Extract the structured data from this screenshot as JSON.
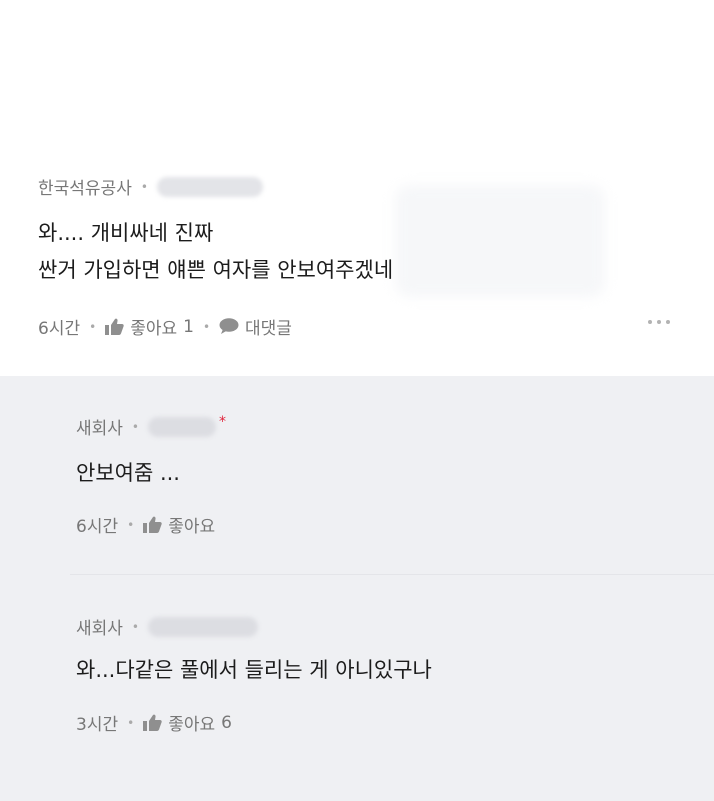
{
  "comment": {
    "author": "한국석유공사",
    "lines": [
      "와.... 개비싸네 진짜",
      "싼거 가입하면 얘쁜 여자를 안보여주겠네"
    ],
    "time": "6시간",
    "like_label": "좋아요",
    "like_count": "1",
    "reply_label": "대댓글",
    "more_icon": "more-dots-icon"
  },
  "replies": [
    {
      "author": "새회사",
      "author_suffix": "*",
      "text": "안보여줌 ...",
      "time": "6시간",
      "like_label": "좋아요",
      "like_count": ""
    },
    {
      "author": "새회사",
      "author_suffix": "",
      "text": "와...다같은 풀에서 들리는 게 아니있구나",
      "time": "3시간",
      "like_label": "좋아요",
      "like_count": "6"
    }
  ],
  "colors": {
    "reply_background": "#eff0f3",
    "accent_red": "#e0243b",
    "meta_gray": "#777777"
  }
}
